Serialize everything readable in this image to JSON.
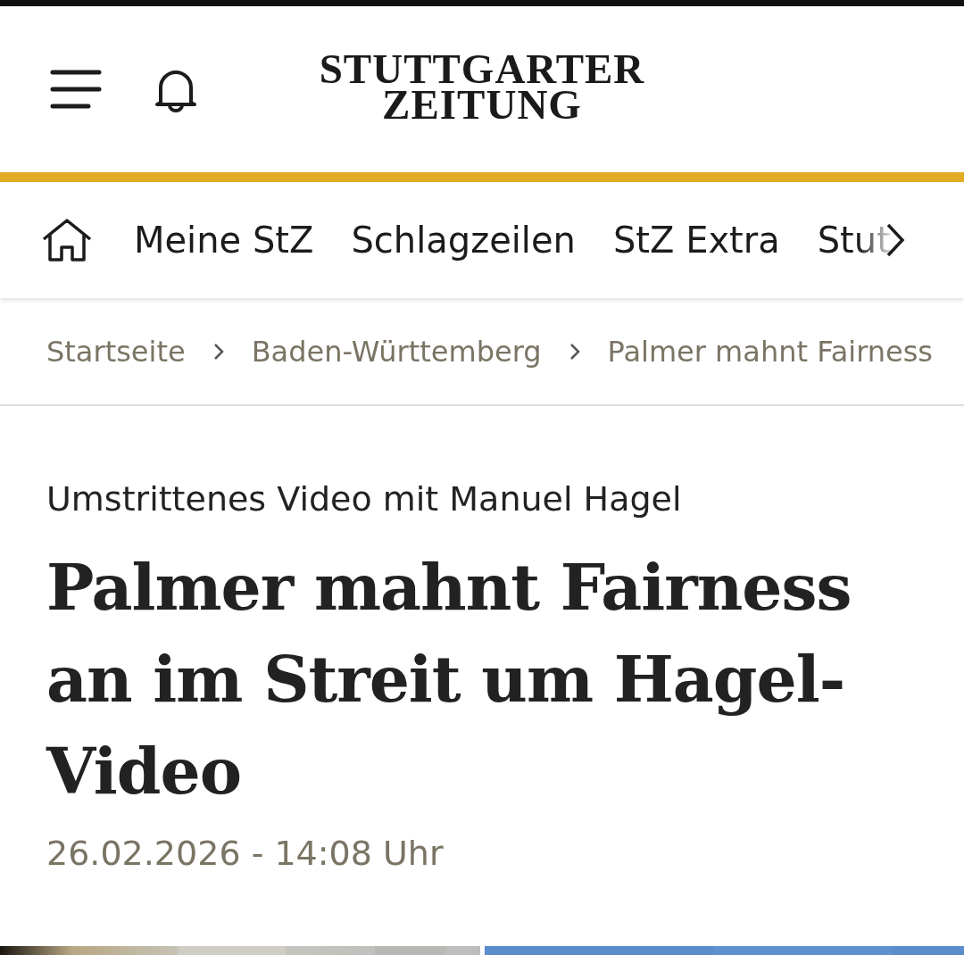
{
  "header": {
    "logo": "STUTTGARTER ZEITUNG"
  },
  "nav": {
    "items": [
      {
        "label": "Meine StZ",
        "faded": false
      },
      {
        "label": "Schlagzeilen",
        "faded": false
      },
      {
        "label": "StZ Extra",
        "faded": false
      },
      {
        "label": "Stut",
        "faded": true
      }
    ]
  },
  "breadcrumb": [
    "Startseite",
    "Baden-Württemberg",
    "Palmer mahnt Fairness"
  ],
  "article": {
    "kicker": "Umstrittenes Video mit Manuel Hagel",
    "title": "Palmer mahnt Fairness an im Streit um Hagel-Video",
    "date": "26.02.2026 - 14:08 Uhr"
  }
}
